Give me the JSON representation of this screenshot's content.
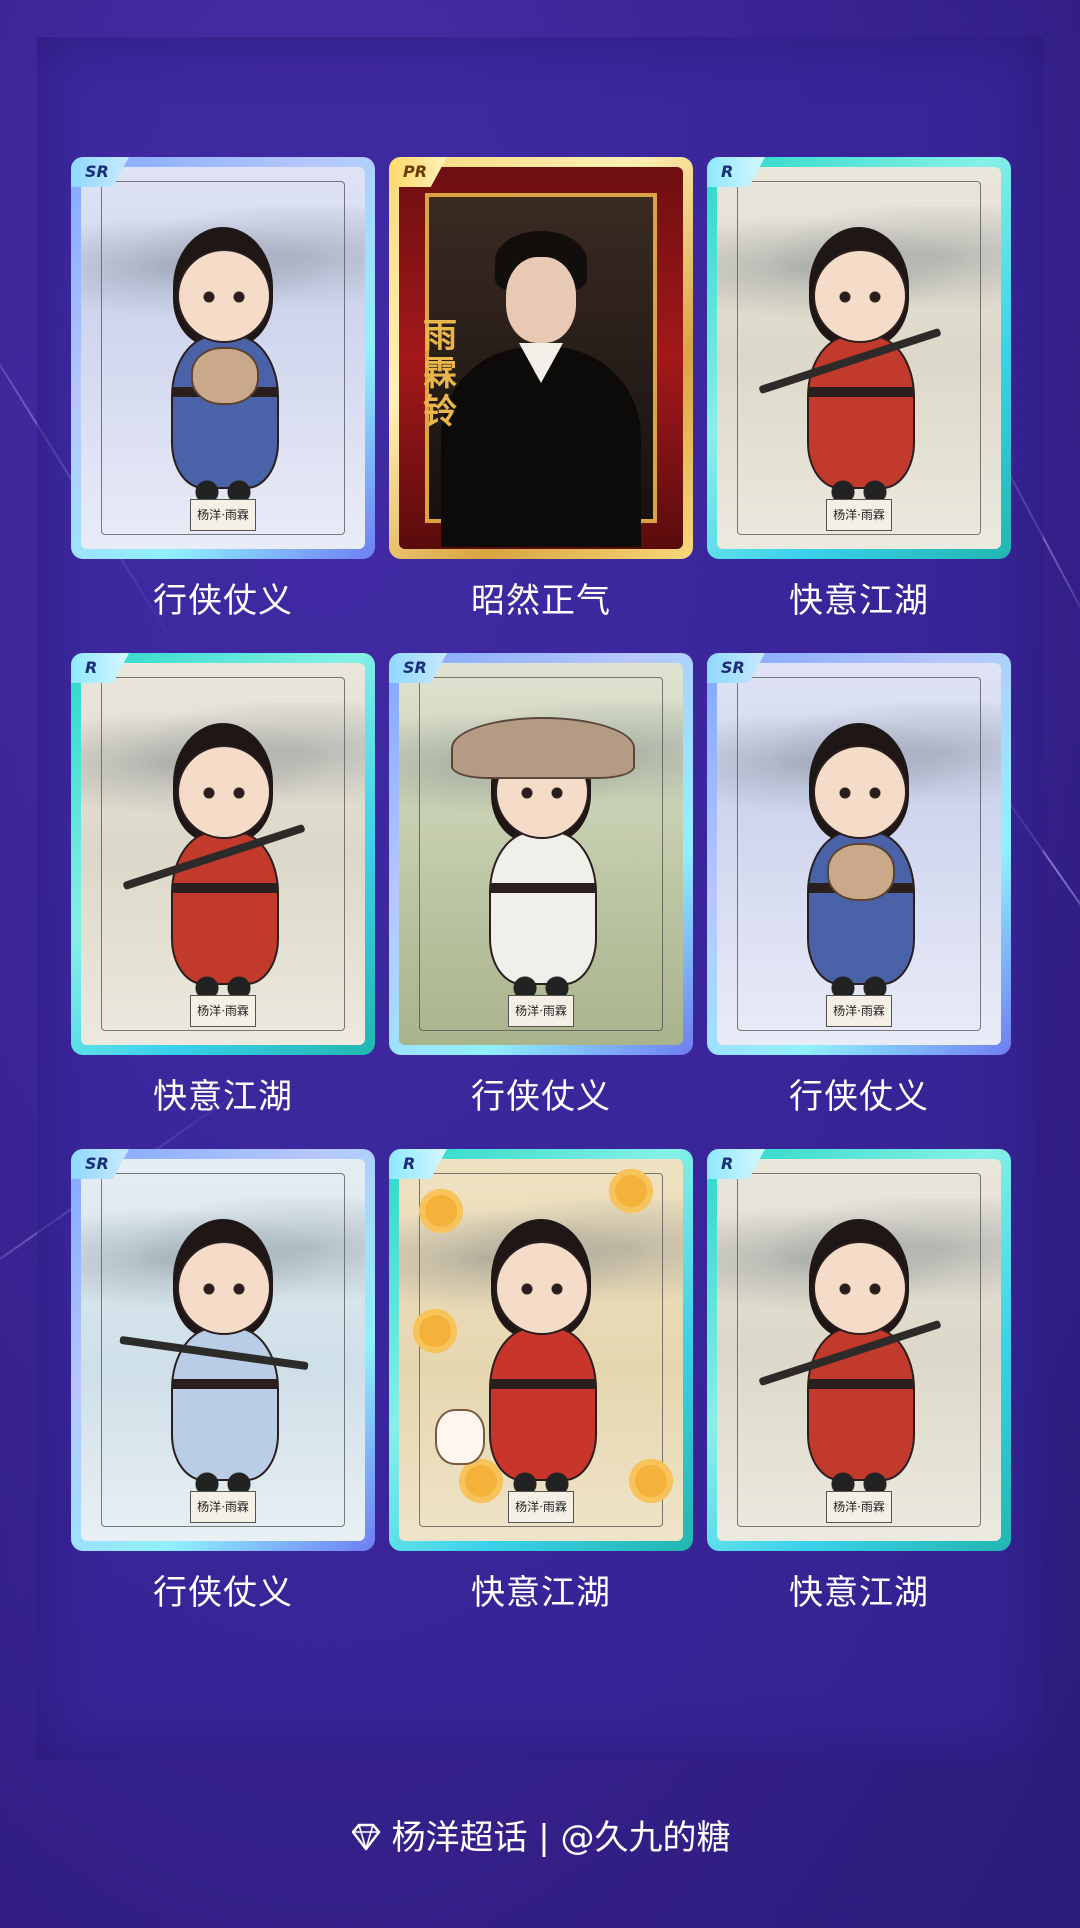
{
  "cards": [
    {
      "rarity": "SR",
      "caption": "行侠仗义",
      "theme": "blue-robe-bear",
      "seal": "杨洋·雨霖"
    },
    {
      "rarity": "PR",
      "caption": "昭然正气",
      "theme": "photo-red-frame",
      "overlay_text": "雨霖铃"
    },
    {
      "rarity": "R",
      "caption": "快意江湖",
      "theme": "red-robe-sword",
      "seal": "杨洋·雨霖"
    },
    {
      "rarity": "R",
      "caption": "快意江湖",
      "theme": "red-robe-sword",
      "seal": "杨洋·雨霖"
    },
    {
      "rarity": "SR",
      "caption": "行侠仗义",
      "theme": "straw-hat-mouse",
      "seal": "杨洋·雨霖"
    },
    {
      "rarity": "SR",
      "caption": "行侠仗义",
      "theme": "blue-robe-bear",
      "seal": "杨洋·雨霖"
    },
    {
      "rarity": "SR",
      "caption": "行侠仗义",
      "theme": "light-blue-sword",
      "seal": "杨洋·雨霖"
    },
    {
      "rarity": "R",
      "caption": "快意江湖",
      "theme": "red-robe-coins-cat",
      "seal": "杨洋·雨霖"
    },
    {
      "rarity": "R",
      "caption": "快意江湖",
      "theme": "red-robe-sword",
      "seal": "杨洋·雨霖"
    }
  ],
  "footer": {
    "icon": "diamond-icon",
    "text": "杨洋超话 | @久九的糖"
  },
  "colors": {
    "background": "#3a2494",
    "panel": "#3a28a0",
    "frame_sr": "#8fb4ff",
    "frame_r": "#2fd6c9",
    "frame_pr": "#f2c85a"
  }
}
